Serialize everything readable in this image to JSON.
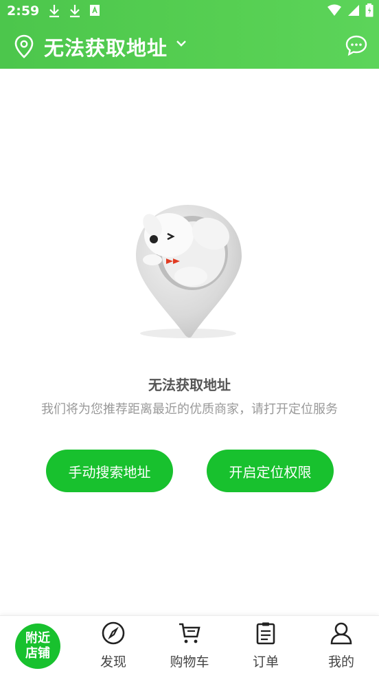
{
  "status_bar": {
    "time": "2:59"
  },
  "header": {
    "location_title": "无法获取地址",
    "colors": {
      "bg": "#52cb50",
      "text": "#ffffff"
    }
  },
  "empty_state": {
    "title": "无法获取地址",
    "description": "我们将为您推荐距离最近的优质商家，请打开定位服务",
    "button_search": "手动搜索地址",
    "button_enable": "开启定位权限",
    "accent": "#18c12e"
  },
  "tabs": {
    "home_line1": "附近",
    "home_line2": "店铺",
    "discover": "发现",
    "cart": "购物车",
    "orders": "订单",
    "mine": "我的"
  }
}
